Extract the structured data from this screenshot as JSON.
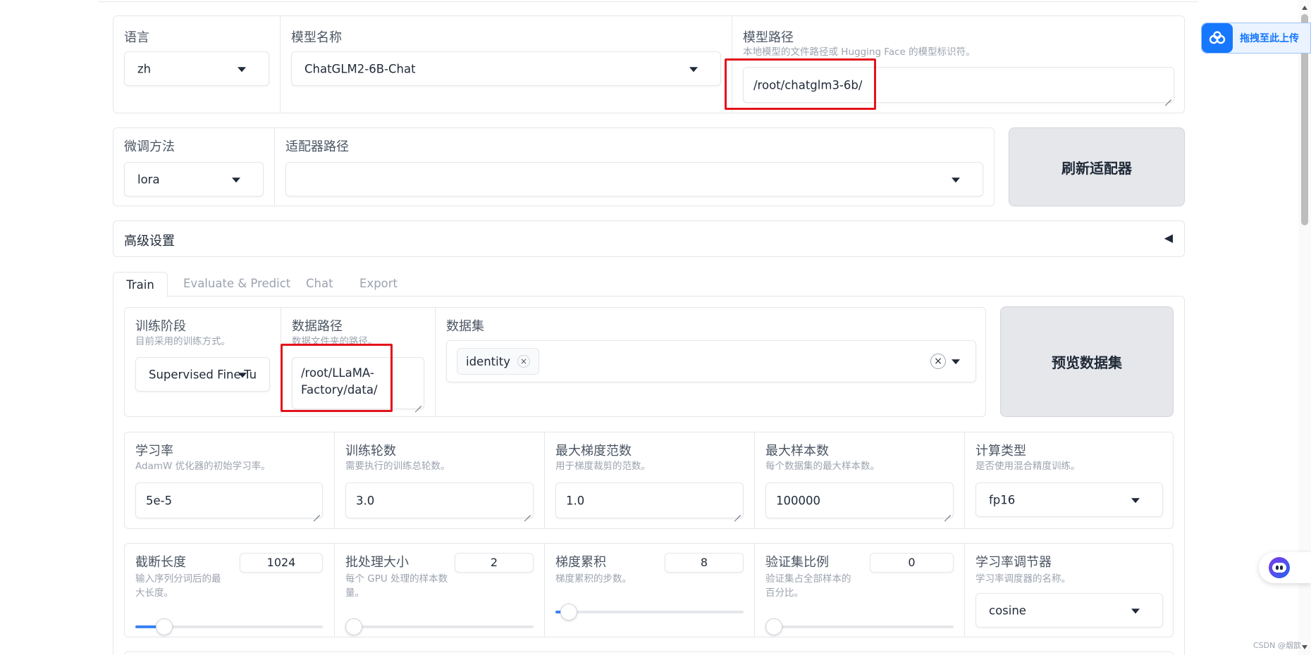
{
  "top": {
    "lang_label": "语言",
    "lang_value": "zh",
    "model_name_label": "模型名称",
    "model_name_value": "ChatGLM2-6B-Chat",
    "model_path_label": "模型路径",
    "model_path_info": "本地模型的文件路径或 Hugging Face 的模型标识符。",
    "model_path_value": "/root/chatglm3-6b/"
  },
  "finetune": {
    "method_label": "微调方法",
    "method_value": "lora",
    "adapter_label": "适配器路径",
    "refresh_button": "刷新适配器"
  },
  "advanced": {
    "label": "高级设置",
    "toggle": "◀"
  },
  "tabs": [
    {
      "label": "Train",
      "active": true
    },
    {
      "label": "Evaluate & Predict",
      "active": false
    },
    {
      "label": "Chat",
      "active": false
    },
    {
      "label": "Export",
      "active": false
    }
  ],
  "train": {
    "stage_label": "训练阶段",
    "stage_info": "目前采用的训练方式。",
    "stage_value": "Supervised Fine-Tur",
    "data_path_label": "数据路径",
    "data_path_info": "数据文件夹的路径。",
    "data_path_value_line1": "/root/LLaMA-",
    "data_path_value_line2": "Factory/data/",
    "dataset_label": "数据集",
    "dataset_tag": "identity",
    "dataset_tag_remove": "×",
    "dataset_clear": "×",
    "preview_button": "预览数据集"
  },
  "params": {
    "lr_label": "学习率",
    "lr_info": "AdamW 优化器的初始学习率。",
    "lr_value": "5e-5",
    "epochs_label": "训练轮数",
    "epochs_info": "需要执行的训练总轮数。",
    "epochs_value": "3.0",
    "grad_norm_label": "最大梯度范数",
    "grad_norm_info": "用于梯度裁剪的范数。",
    "grad_norm_value": "1.0",
    "max_samples_label": "最大样本数",
    "max_samples_info": "每个数据集的最大样本数。",
    "max_samples_value": "100000",
    "compute_label": "计算类型",
    "compute_info": "是否使用混合精度训练。",
    "compute_value": "fp16"
  },
  "sliders": {
    "cutoff_label": "截断长度",
    "cutoff_info_1": "输入序列分词后的最",
    "cutoff_info_2": "大长度。",
    "cutoff_value": "1024",
    "cutoff_fraction": 0.12,
    "batch_label": "批处理大小",
    "batch_info_1": "每个 GPU 处理的样本数",
    "batch_info_2": "量。",
    "batch_value": "2",
    "batch_fraction": 0.0,
    "accum_label": "梯度累积",
    "accum_info": "梯度累积的步数。",
    "accum_value": "8",
    "accum_fraction": 0.03,
    "val_label": "验证集比例",
    "val_info_1": "验证集占全部样本的",
    "val_info_2": "百分比。",
    "val_value": "0",
    "val_fraction": 0.0,
    "sched_label": "学习率调节器",
    "sched_info": "学习率调度器的名称。",
    "sched_value": "cosine"
  },
  "float_upload": "拖拽至此上传",
  "watermark": "CSDN @烟歆",
  "colors": {
    "highlight": "#e3131b",
    "accent_blue": "#1677ff",
    "slider_fill": "#3b82f6"
  }
}
